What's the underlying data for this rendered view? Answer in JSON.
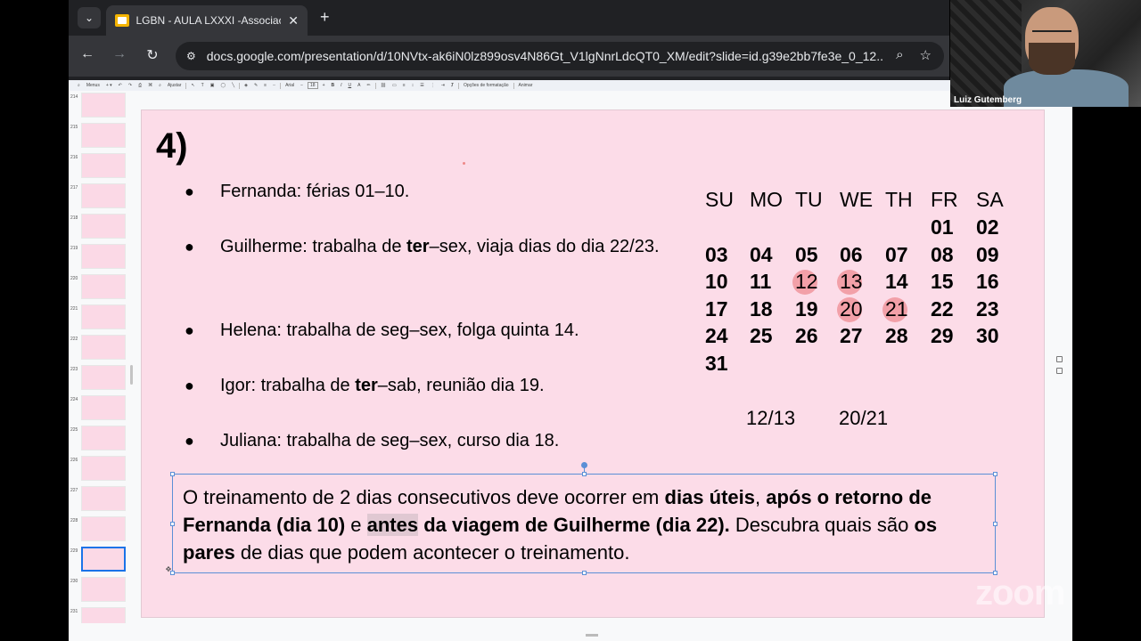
{
  "browser": {
    "tab_title": "LGBN - AULA LXXXI -Associacao",
    "url": "docs.google.com/presentation/d/10NVtx-ak6iN0lz899osv4N86Gt_V1lgNnrLdcQT0_XM/edit?slide=id.g39e2bb7fe3e_0_12...",
    "menu_glyph": "⌄",
    "close_glyph": "✕",
    "new_tab_glyph": "+",
    "back_glyph": "←",
    "forward_glyph": "→",
    "reload_glyph": "↻",
    "site_info_glyph": "⚙",
    "zoom_glyph": "⌕",
    "star_glyph": "☆"
  },
  "slides_toolbar": {
    "menus_label": "Menus",
    "fit_label": "Ajustar",
    "font_label": "Arial",
    "font_size": "18",
    "format_options_label": "Opções de formatação",
    "animate_label": "Animar"
  },
  "filmstrip": {
    "slides": [
      {
        "num": "214"
      },
      {
        "num": "215"
      },
      {
        "num": "216"
      },
      {
        "num": "217"
      },
      {
        "num": "218"
      },
      {
        "num": "219"
      },
      {
        "num": "220"
      },
      {
        "num": "221"
      },
      {
        "num": "222"
      },
      {
        "num": "223"
      },
      {
        "num": "224"
      },
      {
        "num": "225"
      },
      {
        "num": "226"
      },
      {
        "num": "227"
      },
      {
        "num": "228"
      },
      {
        "num": "229"
      },
      {
        "num": "230"
      },
      {
        "num": "231"
      }
    ],
    "selected": "229"
  },
  "slide": {
    "number": "4)",
    "bullets": [
      {
        "dot": "●",
        "pre": "Fernanda: férias 01–10.",
        "bold": "",
        "post": ""
      },
      {
        "dot": "●",
        "pre": "Guilherme: trabalha de ",
        "bold": "ter",
        "post": "–sex, viaja dias do dia 22/23."
      },
      {
        "dot": "●",
        "pre": "Helena: trabalha de seg–sex, folga quinta 14.",
        "bold": "",
        "post": ""
      },
      {
        "dot": "●",
        "pre": "Igor: trabalha de ",
        "bold": "ter",
        "post": "–sab, reunião dia 19."
      },
      {
        "dot": "●",
        "pre": "Juliana: trabalha de seg–sex, curso dia 18.",
        "bold": "",
        "post": ""
      }
    ],
    "calendar": {
      "headers": [
        "SU",
        "MO",
        "TU",
        "WE",
        "TH",
        "FR",
        "SA"
      ],
      "rows": [
        [
          "",
          "",
          "",
          "",
          "",
          "01",
          "02"
        ],
        [
          "03",
          "04",
          "05",
          "06",
          "07",
          "08",
          "09"
        ],
        [
          "10",
          "11",
          "12",
          "13",
          "14",
          "15",
          "16"
        ],
        [
          "17",
          "18",
          "19",
          "20",
          "21",
          "22",
          "23"
        ],
        [
          "24",
          "25",
          "26",
          "27",
          "28",
          "29",
          "30"
        ],
        [
          "31",
          "",
          "",
          "",
          "",
          "",
          ""
        ]
      ],
      "highlighted": [
        "12",
        "13",
        "20",
        "21"
      ],
      "highlight_color": "#f2a0a8"
    },
    "pairs": [
      "12/13",
      "20/21"
    ],
    "textbox": {
      "t1": "O treinamento de 2 dias consecutivos deve ocorrer em ",
      "b1": "dias úteis",
      "t2": ", ",
      "b2": "após o retorno de Fernanda (dia 10)",
      "t3": " e ",
      "b3": "antes",
      "b4": " da viagem de Guilherme (dia 22).",
      "t4": " Descubra quais são ",
      "b5": "os pares",
      "t5": " de dias que podem acontecer o treinamento."
    },
    "background_color": "#fcdce8"
  },
  "video": {
    "participant_name": "Luiz Gutemberg"
  },
  "watermark": "zoom"
}
